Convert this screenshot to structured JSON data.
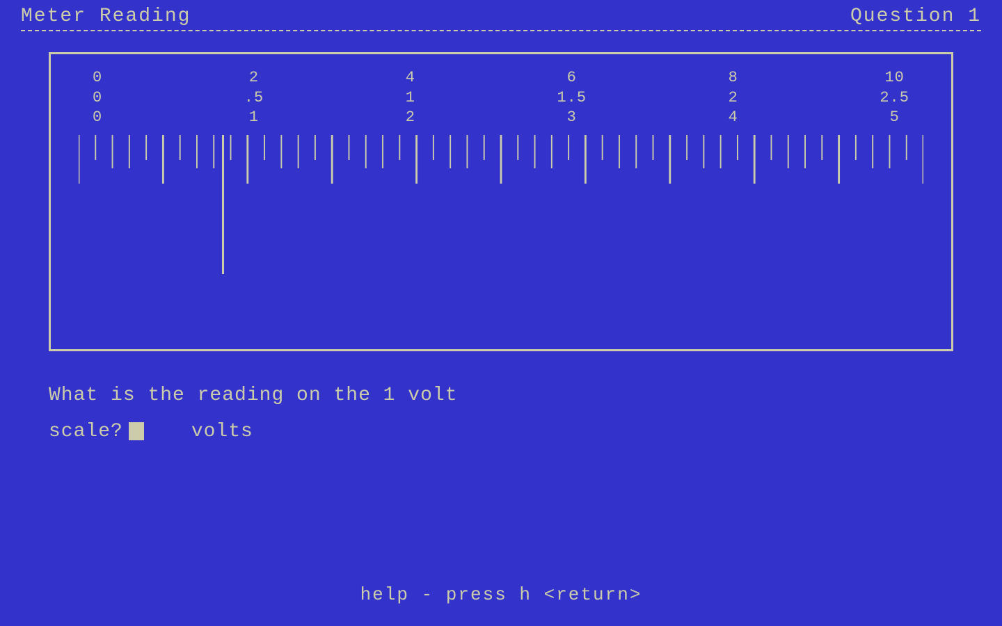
{
  "header": {
    "title": "Meter Reading",
    "question_label": "Question 1"
  },
  "scale": {
    "groups": [
      {
        "lines": [
          "0",
          "0",
          "0"
        ]
      },
      {
        "lines": [
          "2",
          ".5",
          "1"
        ]
      },
      {
        "lines": [
          "4",
          "1",
          "2"
        ]
      },
      {
        "lines": [
          "6",
          "1.5",
          "3"
        ]
      },
      {
        "lines": [
          "8",
          "2",
          "4"
        ]
      },
      {
        "lines": [
          "10",
          "2.5",
          "5"
        ]
      }
    ]
  },
  "question": {
    "line1": "What is the reading on the 1 volt",
    "line2_prefix": "scale?",
    "line2_suffix": "volts"
  },
  "help": {
    "text": "help - press    h <return>"
  }
}
